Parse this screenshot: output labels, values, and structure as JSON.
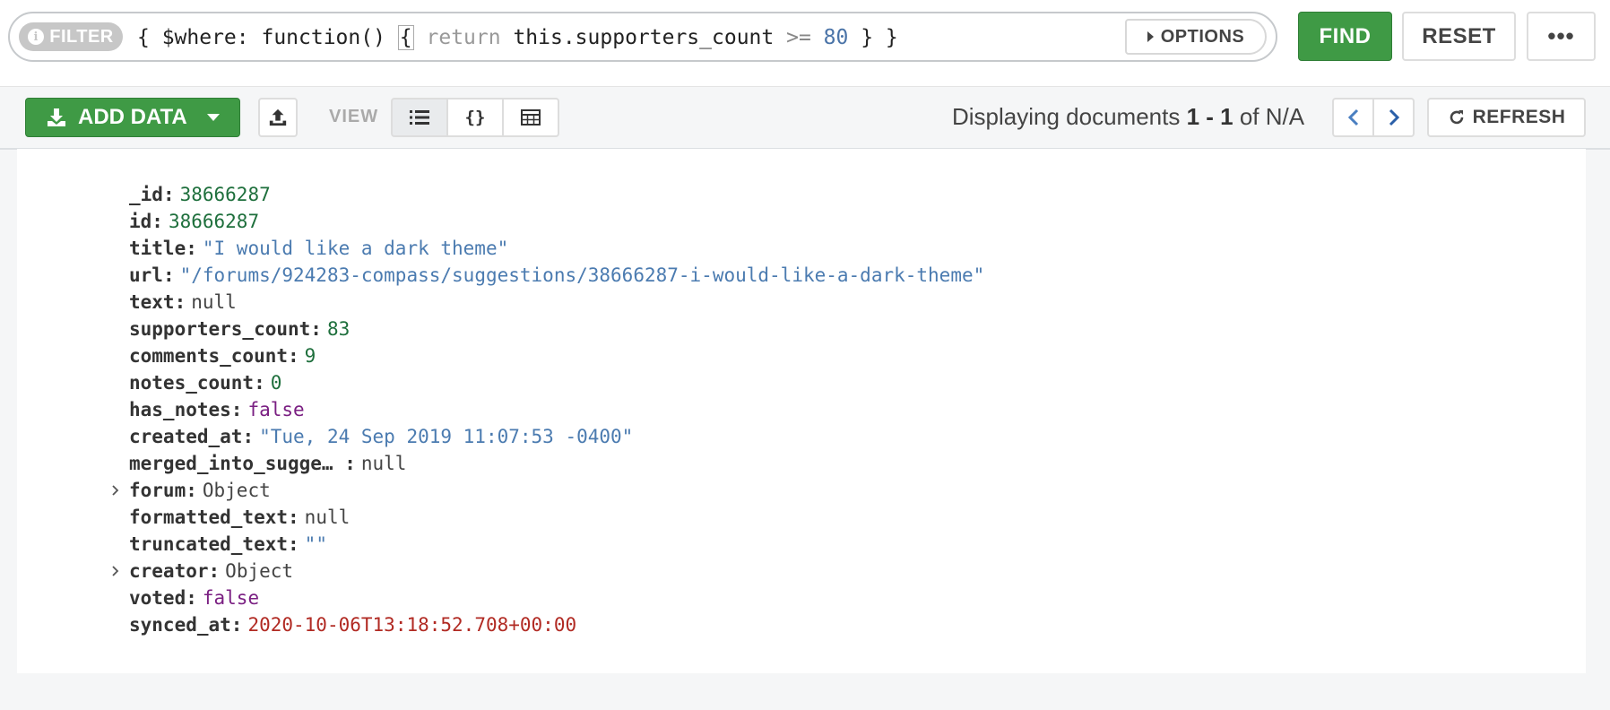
{
  "querybar": {
    "filter_label": "FILTER",
    "info_glyph": "i",
    "query": {
      "open": "{ $where: function() ",
      "brace": "{",
      "kw": " return",
      "body": " this.supporters_count ",
      "op": ">=",
      "num": " 80",
      "close": " } }"
    },
    "options_label": "OPTIONS",
    "find_label": "FIND",
    "reset_label": "RESET",
    "more_label": "•••"
  },
  "toolbar": {
    "add_data_label": "ADD DATA",
    "view_label": "VIEW",
    "view_json_glyph": "{}",
    "displaying_prefix": "Displaying documents ",
    "range_start": "1",
    "range_dash": " - ",
    "range_end": "1",
    "of_text": " of N/A",
    "refresh_label": "REFRESH"
  },
  "document": [
    {
      "key": "_id",
      "value": "38666287",
      "type": "num"
    },
    {
      "key": "id",
      "value": "38666287",
      "type": "num"
    },
    {
      "key": "title",
      "value": "\"I would like a dark theme\"",
      "type": "str"
    },
    {
      "key": "url",
      "value": "\"/forums/924283-compass/suggestions/38666287-i-would-like-a-dark-theme\"",
      "type": "str"
    },
    {
      "key": "text",
      "value": "null",
      "type": "null"
    },
    {
      "key": "supporters_count",
      "value": "83",
      "type": "num"
    },
    {
      "key": "comments_count",
      "value": "9",
      "type": "num"
    },
    {
      "key": "notes_count",
      "value": "0",
      "type": "num"
    },
    {
      "key": "has_notes",
      "value": "false",
      "type": "bool"
    },
    {
      "key": "created_at",
      "value": "\"Tue, 24 Sep 2019 11:07:53 -0400\"",
      "type": "str"
    },
    {
      "key": "merged_into_sugge… ",
      "value": "null",
      "type": "null"
    },
    {
      "key": "forum",
      "value": "Object",
      "type": "obj",
      "expandable": true
    },
    {
      "key": "formatted_text",
      "value": "null",
      "type": "null"
    },
    {
      "key": "truncated_text",
      "value": "\"\"",
      "type": "str"
    },
    {
      "key": "creator",
      "value": "Object",
      "type": "obj",
      "expandable": true
    },
    {
      "key": "voted",
      "value": "false",
      "type": "bool"
    },
    {
      "key": "synced_at",
      "value": "2020-10-06T13:18:52.708+00:00",
      "type": "date"
    }
  ],
  "colors": {
    "green": "#3f9a45",
    "number": "#1e6f3c",
    "string": "#4b7bb0",
    "boolean": "#7a1f82",
    "date": "#b12a23"
  },
  "icons": {
    "filter_info": "info-icon",
    "options": "caret-right-icon",
    "add_data": "download-icon",
    "export": "upload-icon",
    "list_view": "list-icon",
    "json_view": "braces-icon",
    "table_view": "table-icon",
    "prev": "chevron-left-icon",
    "next": "chevron-right-icon",
    "refresh": "refresh-icon",
    "expand": "chevron-right-icon"
  }
}
